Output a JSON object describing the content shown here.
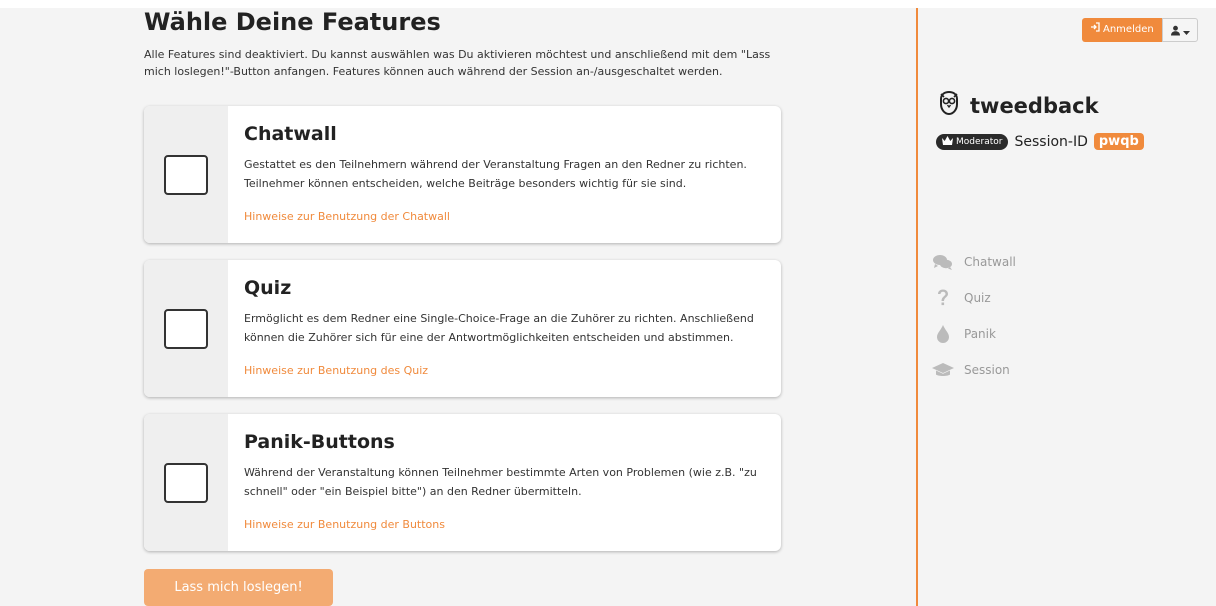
{
  "main": {
    "title": "Wähle Deine Features",
    "intro": "Alle Features sind deaktiviert. Du kannst auswählen was Du aktivieren möchtest und anschließend mit dem \"Lass mich loslegen!\"-Button anfangen. Features können auch während der Session an-/ausgeschaltet werden.",
    "features": [
      {
        "title": "Chatwall",
        "description": "Gestattet es den Teilnehmern während der Veranstaltung Fragen an den Redner zu richten. Teilnehmer können entscheiden, welche Beiträge besonders wichtig für sie sind.",
        "link": "Hinweise zur Benutzung der Chatwall",
        "checked": false
      },
      {
        "title": "Quiz",
        "description": "Ermöglicht es dem Redner eine Single-Choice-Frage an die Zuhörer zu richten. Anschließend können die Zuhörer sich für eine der Antwortmöglichkeiten entscheiden und abstimmen.",
        "link": "Hinweise zur Benutzung des Quiz",
        "checked": false
      },
      {
        "title": "Panik-Buttons",
        "description": "Während der Veranstaltung können Teilnehmer bestimmte Arten von Problemen (wie z.B. \"zu schnell\" oder \"ein Beispiel bitte\") an den Redner übermitteln.",
        "link": "Hinweise zur Benutzung der Buttons",
        "checked": false
      }
    ],
    "start_button": "Lass mich loslegen!"
  },
  "header": {
    "login_label": "Anmelden",
    "login_icon": "sign-in-icon",
    "user_icon": "user-icon"
  },
  "sidebar": {
    "brand": "tweedback",
    "role_badge": "Moderator",
    "session_label": "Session-ID",
    "session_id": "pwqb",
    "nav": [
      {
        "label": "Chatwall",
        "icon": "comments-icon"
      },
      {
        "label": "Quiz",
        "icon": "question-icon"
      },
      {
        "label": "Panik",
        "icon": "drop-icon"
      },
      {
        "label": "Session",
        "icon": "graduation-cap-icon"
      }
    ]
  },
  "colors": {
    "accent": "#f08a3c",
    "accent_light": "#f3ab72",
    "nav_gray": "#999999",
    "background": "#f4f4f4"
  }
}
